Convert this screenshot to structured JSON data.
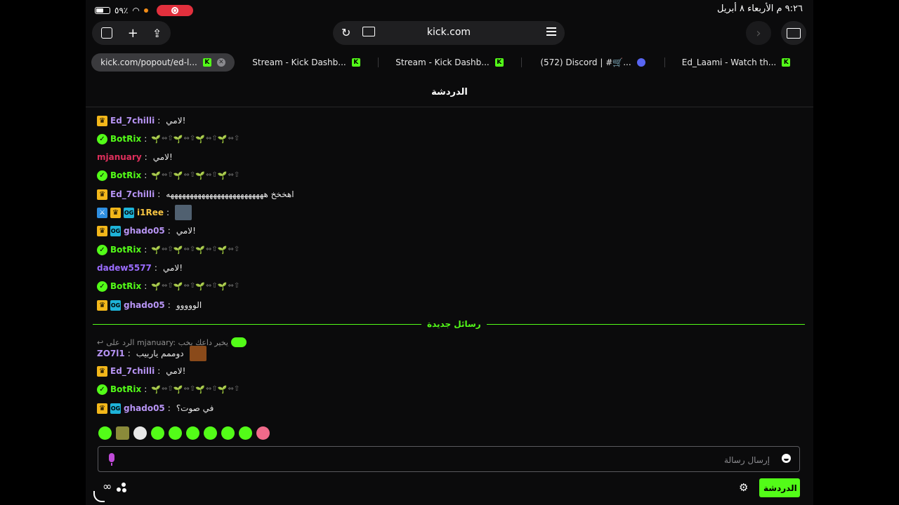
{
  "status": {
    "battery": "٥٩٪",
    "datetime": "٩:٢٦ م   الأربعاء ٨ أبريل"
  },
  "browser": {
    "url": "kick.com",
    "tabs": [
      {
        "title": "kick.com/popout/ed-l...",
        "icon": "kick",
        "active": true
      },
      {
        "title": "Stream - Kick Dashb...",
        "icon": "kick"
      },
      {
        "title": "Stream - Kick Dashb...",
        "icon": "kick"
      },
      {
        "title": "(572) Discord | #🛒...",
        "icon": "discord"
      },
      {
        "title": "Ed_Laami - Watch th...",
        "icon": "kick"
      }
    ]
  },
  "chat": {
    "header": "الدردشة",
    "divider_label": "رسائل جديدة",
    "reply_context": "الرد على mjanuary: يخير داعك يخب",
    "messages": [
      {
        "user": "Ed_7chilli",
        "color": "#b794f4",
        "text": "لامي!"
      },
      {
        "user": "BotRix",
        "color": "#53fc18",
        "text": ""
      },
      {
        "user": "mjanuary",
        "color": "#e02f5c",
        "text": "لامي!"
      },
      {
        "user": "BotRix",
        "color": "#53fc18",
        "text": ""
      },
      {
        "user": "Ed_7chilli",
        "color": "#b794f4",
        "text": "اهخخخ هههههههههههههههههههههههههه"
      },
      {
        "user": "i1Ree",
        "color": "#f5c342",
        "text": ""
      },
      {
        "user": "ghado05",
        "color": "#b794f4",
        "text": "لامي!"
      },
      {
        "user": "BotRix",
        "color": "#53fc18",
        "text": ""
      },
      {
        "user": "dadew5577",
        "color": "#9b6cff",
        "text": "لامي!"
      },
      {
        "user": "BotRix",
        "color": "#53fc18",
        "text": ""
      },
      {
        "user": "ghado05",
        "color": "#b794f4",
        "text": "الووووو"
      },
      {
        "user": "ZO7l1",
        "color": "#b794f4",
        "text": "دوممم ياربيب"
      },
      {
        "user": "Ed_7chilli",
        "color": "#b794f4",
        "text": "لامي!"
      },
      {
        "user": "BotRix",
        "color": "#53fc18",
        "text": ""
      },
      {
        "user": "ghado05",
        "color": "#b794f4",
        "text": "في صوت؟"
      }
    ],
    "input_placeholder": "إرسال رسالة",
    "send_button": "الدردشة"
  },
  "colors": {
    "accent": "#53fc18",
    "background": "#0b0b0c"
  }
}
